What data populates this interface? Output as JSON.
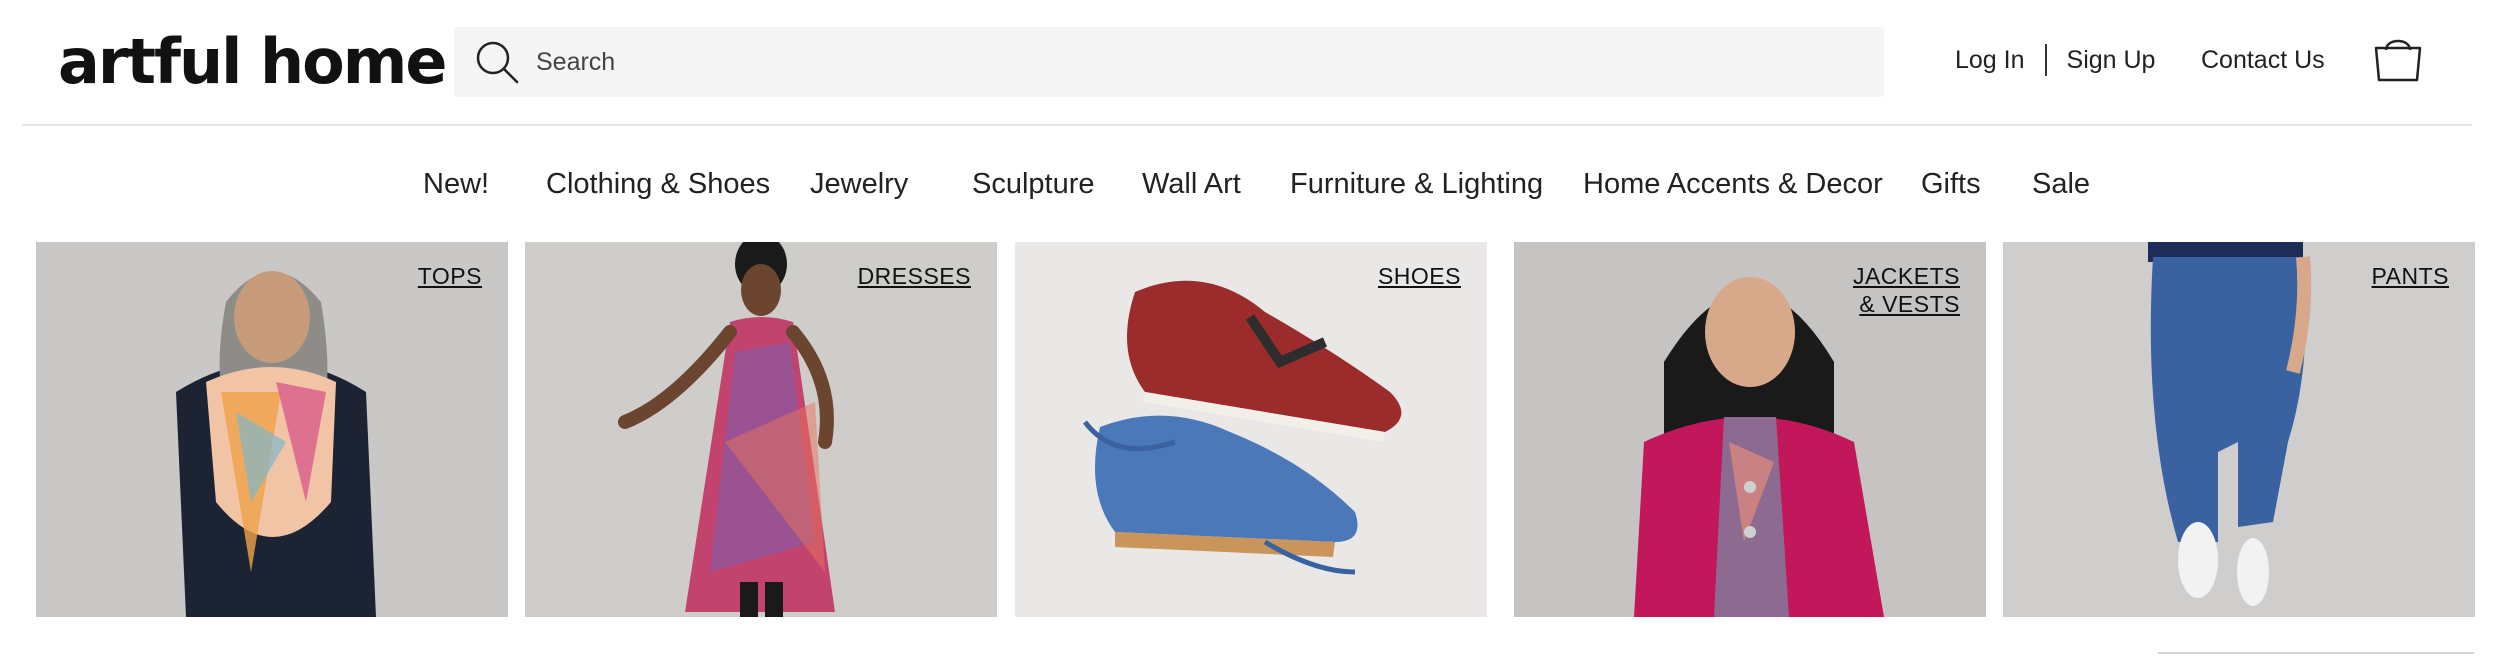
{
  "header": {
    "logo": "artful home",
    "search": {
      "placeholder": "Search",
      "value": ""
    },
    "login": "Log In",
    "signup": "Sign Up",
    "contact": "Contact Us",
    "bag_icon": "shopping-bag-icon",
    "search_icon": "search-icon"
  },
  "nav": {
    "items": [
      {
        "label": "New!"
      },
      {
        "label": "Clothing & Shoes"
      },
      {
        "label": "Jewelry"
      },
      {
        "label": "Sculpture"
      },
      {
        "label": "Wall Art"
      },
      {
        "label": "Furniture & Lighting"
      },
      {
        "label": "Home Accents & Decor"
      },
      {
        "label": "Gifts"
      },
      {
        "label": "Sale"
      }
    ]
  },
  "categories": [
    {
      "label": "TOPS",
      "line2": "",
      "bg": "#c9c8c6"
    },
    {
      "label": "DRESSES",
      "line2": "",
      "bg": "#cfcdca"
    },
    {
      "label": "SHOES",
      "line2": "",
      "bg": "#e9e8e6"
    },
    {
      "label": "JACKETS",
      "line2": "& VESTS",
      "bg": "#c6c4c2"
    },
    {
      "label": "PANTS",
      "line2": "",
      "bg": "#cfcecc"
    }
  ],
  "colors": {
    "accent_magenta": "#c2185b",
    "denim": "#3a62a0",
    "shoe_red": "#9c2b2b",
    "shoe_blue": "#4a78b8"
  }
}
